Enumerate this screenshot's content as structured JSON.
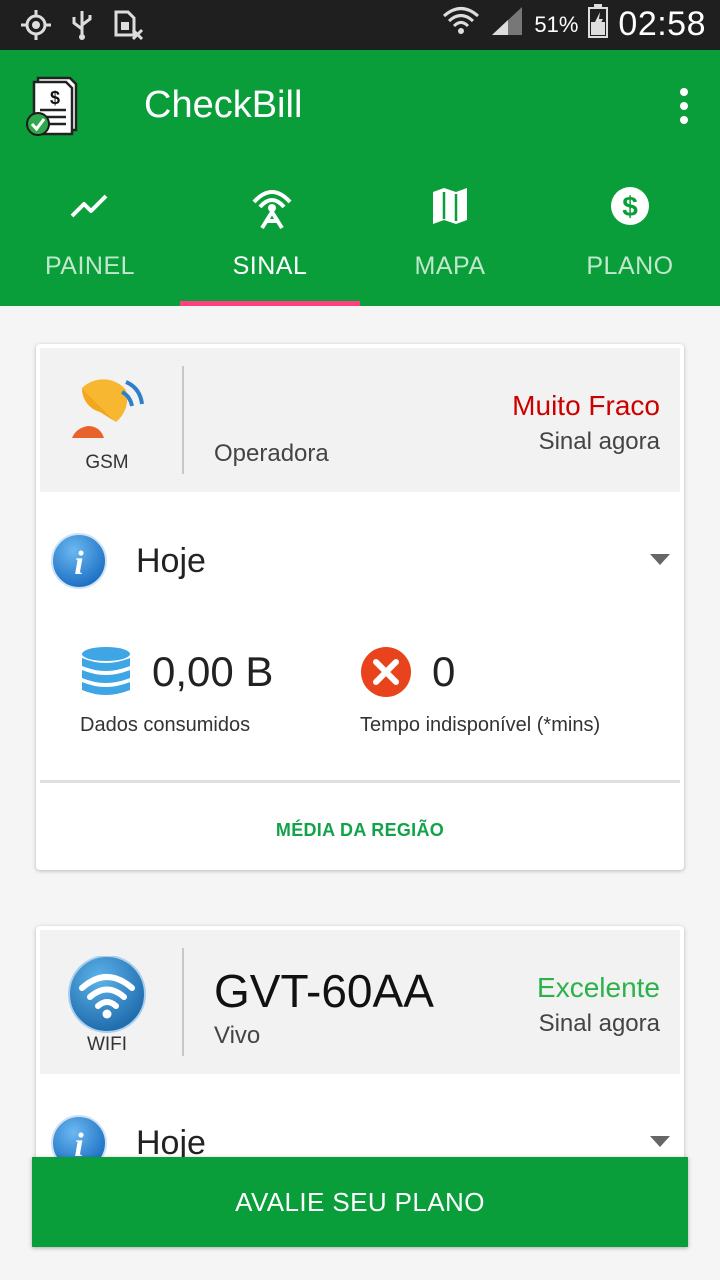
{
  "status_bar": {
    "battery_percent": "51%",
    "time": "02:58",
    "icons": [
      "location-icon",
      "usb-icon",
      "sim-icon",
      "wifi-icon",
      "cell-signal-icon",
      "battery-icon"
    ]
  },
  "app_bar": {
    "title": "CheckBill",
    "color": "#0a9e3a"
  },
  "tabs": [
    {
      "label": "PAINEL",
      "icon": "trending-icon",
      "active": false
    },
    {
      "label": "SINAL",
      "icon": "antenna-icon",
      "active": true
    },
    {
      "label": "MAPA",
      "icon": "map-icon",
      "active": false
    },
    {
      "label": "PLANO",
      "icon": "dollar-icon",
      "active": false
    }
  ],
  "cards": [
    {
      "type": "GSM",
      "main": "",
      "sub": "Operadora",
      "status": "Muito Fraco",
      "status_color": "#cc0000",
      "status_sub": "Sinal agora",
      "period": "Hoje",
      "data_value": "0,00 B",
      "data_label": "Dados consumidos",
      "downtime_value": "0",
      "downtime_label": "Tempo indisponível (*mins)",
      "action": "MÉDIA DA REGIÃO"
    },
    {
      "type": "WIFI",
      "main": "GVT-60AA",
      "sub": "Vivo",
      "status": "Excelente",
      "status_color": "#2bb34a",
      "status_sub": "Sinal agora",
      "period": "Hoje"
    }
  ],
  "bottom_button": {
    "label": "AVALIE SEU PLANO"
  }
}
